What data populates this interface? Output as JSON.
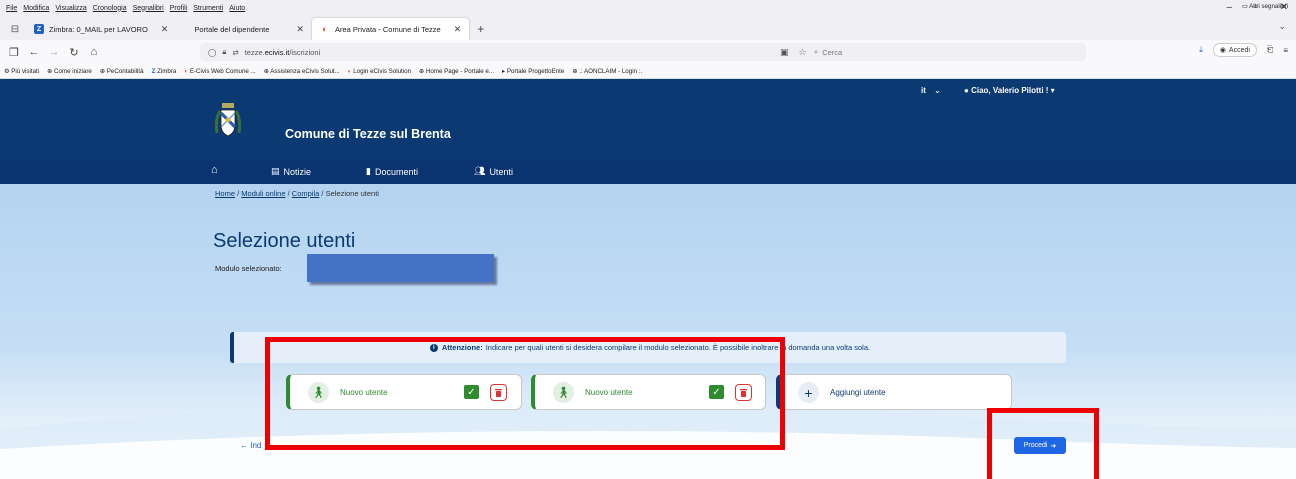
{
  "menubar": {
    "items": [
      "File",
      "Modifica",
      "Visualizza",
      "Cronologia",
      "Segnalibri",
      "Profili",
      "Strumenti",
      "Aiuto"
    ]
  },
  "tabs": [
    {
      "label": "Zimbra: 0_MAIL per LAVORO",
      "favicon": "zimbra-icon",
      "color": "#2260c7"
    },
    {
      "label": "Portale del dipendente",
      "favicon": "none",
      "color": ""
    },
    {
      "label": "Area Privata - Comune di Tezze",
      "favicon": "ecivis-icon",
      "color": "#e0472b",
      "active": true
    }
  ],
  "urlbar": {
    "prefix": "tezze.",
    "host": "ecivis.it",
    "path": "/iscrizioni",
    "search_placeholder": "Cerca"
  },
  "toolbar": {
    "accedi_label": "Accedi"
  },
  "bookmarks": {
    "items": [
      "Più visitati",
      "Come iniziare",
      "PeContabilità",
      "Zimbra",
      "E-Civis Web Comune ...",
      "Assistenza eCivis Solut...",
      "Login eCivis Solution",
      "Home Page - Portale e...",
      "Portale ProgettoEnte",
      ".: AONCLAIM - Login :."
    ],
    "other_label": "Altri segnalibri"
  },
  "header": {
    "lang": "it",
    "user_greeting": "Ciao, Valerio Pilotti !",
    "site_title": "Comune di Tezze sul Brenta"
  },
  "mainnav": {
    "items": [
      {
        "label": "",
        "icon": "home-icon"
      },
      {
        "label": "Notizie",
        "icon": "newspaper-icon"
      },
      {
        "label": "Documenti",
        "icon": "document-icon"
      },
      {
        "label": "Utenti",
        "icon": "users-icon"
      }
    ]
  },
  "breadcrumb": {
    "home": "Home",
    "moduli": "Moduli online",
    "compila": "Compila",
    "current": "Selezione utenti",
    "sep": "/"
  },
  "main": {
    "title": "Selezione utenti",
    "modulo_label": "Modulo selezionato:",
    "alert_bold": "Attenzione:",
    "alert_text": "Indicare per quali utenti si desidera compilare il modulo selezionato. È possibile inoltrare la domanda una volta sola.",
    "users": [
      {
        "label": "Nuovo utente",
        "selected": true
      },
      {
        "label": "Nuovo utente",
        "selected": true
      }
    ],
    "add_user_label": "Aggiungi utente",
    "back_label": "Indietro",
    "back_visible": "Ind",
    "procedi_label": "Procedi"
  },
  "colors": {
    "header_blue": "#0b3a73",
    "success_green": "#2e8b2e",
    "primary_button": "#1f66e5",
    "annotation_red": "#ee0000",
    "redaction_blue": "#4472c4"
  }
}
